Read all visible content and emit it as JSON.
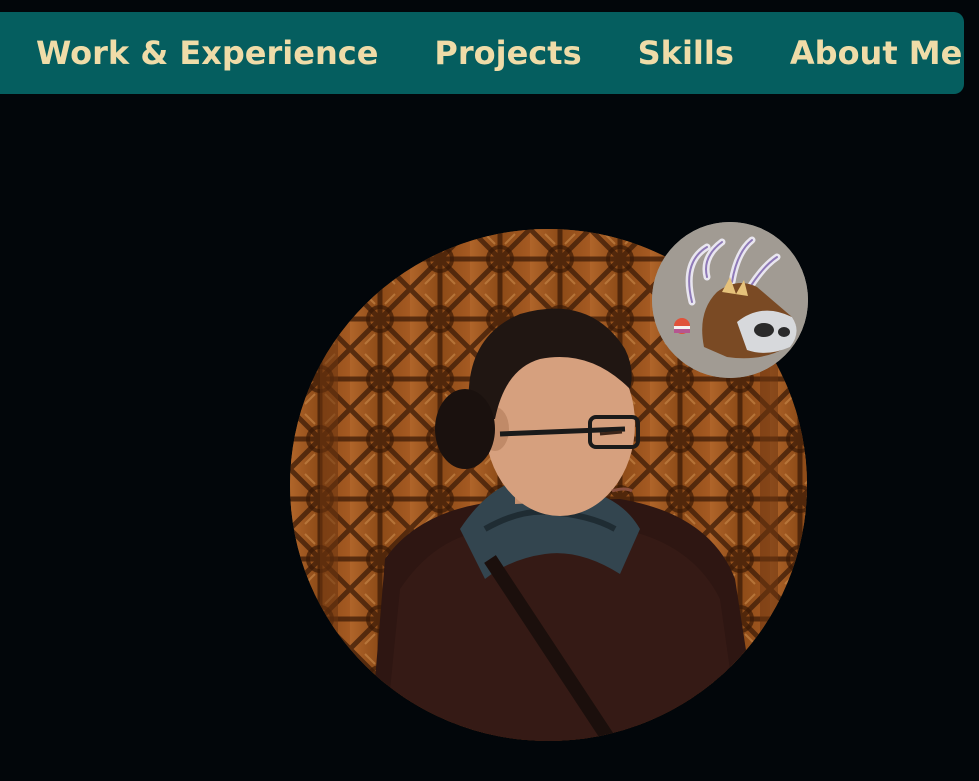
{
  "nav": {
    "items": [
      {
        "label": "Work & Experience"
      },
      {
        "label": "Projects"
      },
      {
        "label": "Skills"
      },
      {
        "label": "About Me"
      }
    ]
  },
  "colors": {
    "page_background": "#02060a",
    "nav_background": "#055e5f",
    "nav_text": "#efdca8",
    "portrait_wood": "#8a4f1c",
    "badge_background": "#a19b93"
  },
  "images": {
    "portrait": "profile-photo",
    "badge": "character-avatar-icon"
  }
}
